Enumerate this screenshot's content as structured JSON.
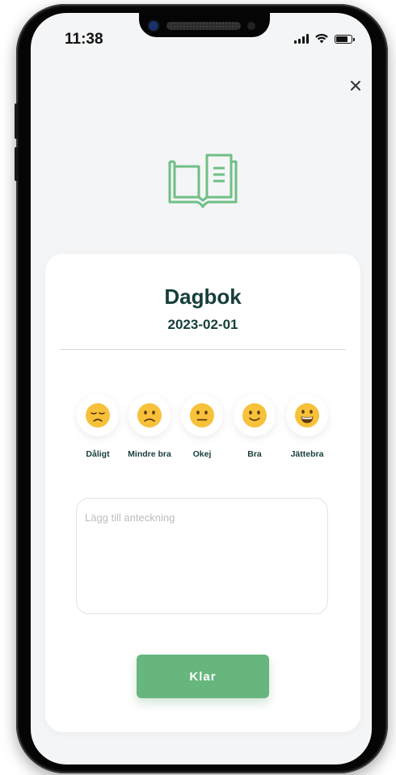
{
  "status_bar": {
    "time": "11:38",
    "battery_level": 0.8
  },
  "close_icon": "close-icon",
  "header_icon": "open-book-icon",
  "colors": {
    "accent": "#67b67e",
    "title": "#163e3a",
    "icon_green": "#6fbf85"
  },
  "card": {
    "title": "Dagbok",
    "date": "2023-02-01",
    "moods": [
      {
        "label": "Dåligt",
        "icon": "disappointed-face-icon"
      },
      {
        "label": "Mindre bra",
        "icon": "slightly-frowning-face-icon"
      },
      {
        "label": "Okej",
        "icon": "neutral-face-icon"
      },
      {
        "label": "Bra",
        "icon": "slightly-smiling-face-icon"
      },
      {
        "label": "Jättebra",
        "icon": "grinning-face-icon"
      }
    ],
    "note_placeholder": "Lägg till anteckning",
    "note_value": "",
    "done_label": "Klar"
  }
}
